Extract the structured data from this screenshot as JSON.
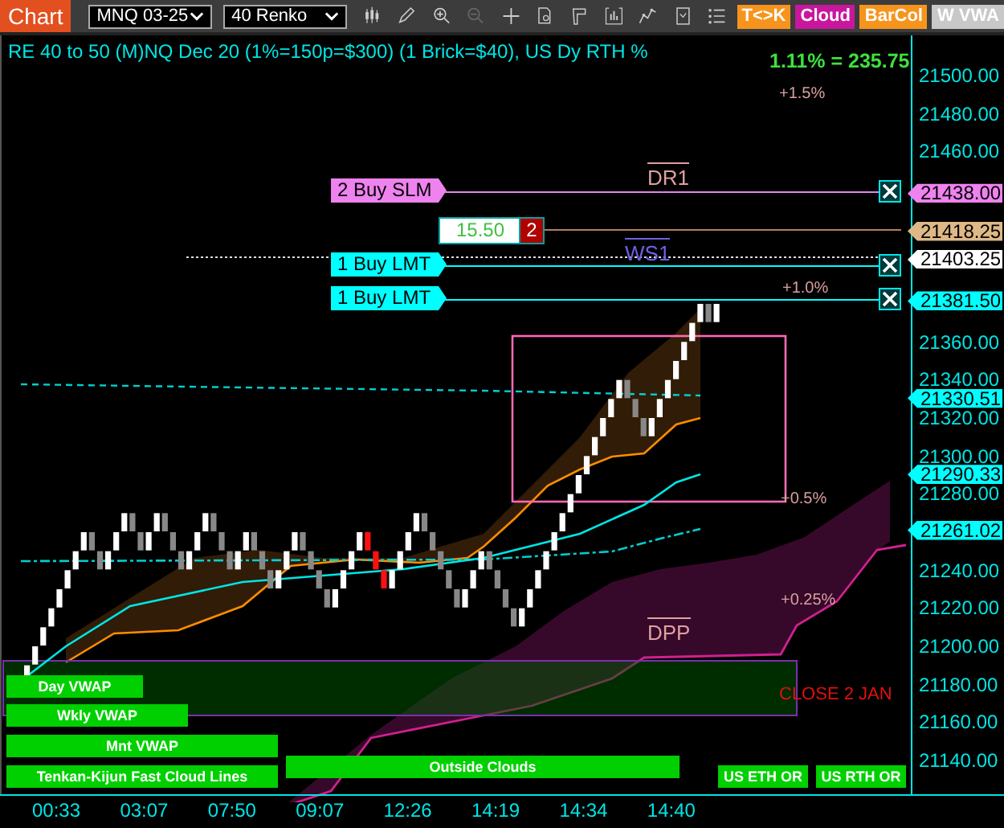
{
  "toolbar": {
    "title": "Chart",
    "instrument": "MNQ 03-25",
    "bar_type": "40 Renko",
    "buttons": [
      {
        "label": "T<>K",
        "color": "#f7941d"
      },
      {
        "label": "Cloud",
        "color": "#c8179e"
      },
      {
        "label": "BarCol",
        "color": "#f7941d"
      },
      {
        "label": "W VWA",
        "color": "#c8c8c8"
      }
    ]
  },
  "chart": {
    "title": "RE 40 to 50 (M)NQ Dec 20 (1%=150p=$300) (1 Brick=$40), US Dy RTH %",
    "change": "1.11% = 235.75",
    "annotations": [
      {
        "text": "+1.5%",
        "kind": "level"
      },
      {
        "text": "DR1",
        "kind": "pivot"
      },
      {
        "text": "WS1",
        "kind": "weekly"
      },
      {
        "text": "+1.0%",
        "kind": "level"
      },
      {
        "text": "+0.5%",
        "kind": "level"
      },
      {
        "text": "+0.25%",
        "kind": "level"
      },
      {
        "text": "DPP",
        "kind": "pivot"
      },
      {
        "text": "CLOSE 2 JAN",
        "kind": "note"
      }
    ],
    "orders": [
      {
        "label": "2 Buy SLM",
        "kind": "stop"
      },
      {
        "label": "1 Buy LMT",
        "kind": "limit"
      },
      {
        "label": "1 Buy LMT",
        "kind": "limit"
      }
    ],
    "position": {
      "value": "15.50",
      "quantity": "2"
    },
    "indicator_labels": [
      "Day VWAP",
      "Wkly VWAP",
      "Mnt VWAP",
      "Tenkan-Kijun Fast Cloud Lines",
      "Outside Clouds",
      "US ETH OR",
      "US RTH OR"
    ]
  },
  "price_axis": {
    "ticks": [
      "21500.00",
      "21480.00",
      "21460.00",
      "21360.00",
      "21340.00",
      "21320.00",
      "21300.00",
      "21280.00",
      "21240.00",
      "21220.00",
      "21200.00",
      "21180.00",
      "21160.00",
      "21140.00"
    ],
    "markers": [
      {
        "price": "21438.00",
        "color": "#ee82ee"
      },
      {
        "price": "21418.25",
        "color": "#deb887"
      },
      {
        "price": "21403.25",
        "color": "#ffffff"
      },
      {
        "price": "21381.50",
        "color": "#00ffff"
      },
      {
        "price": "21330.51",
        "color": "#00ffff"
      },
      {
        "price": "21290.33",
        "color": "#00ffff"
      },
      {
        "price": "21261.02",
        "color": "#00ffff"
      }
    ]
  },
  "time_axis": [
    "00:33",
    "03:07",
    "07:50",
    "09:07",
    "12:26",
    "14:19",
    "14:34",
    "14:40"
  ]
}
